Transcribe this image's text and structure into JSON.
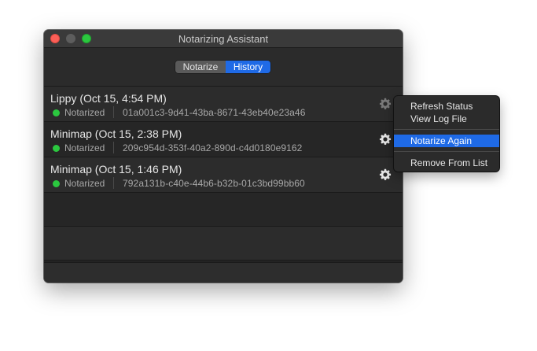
{
  "window": {
    "title": "Notarizing Assistant"
  },
  "tabs": {
    "notarize": "Notarize",
    "history": "History",
    "selected": "History"
  },
  "history": [
    {
      "name": "Lippy (Oct 15, 4:54 PM)",
      "status": "Notarized",
      "id": "01a001c3-9d41-43ba-8671-43eb40e23a46",
      "status_color": "#2bc83f"
    },
    {
      "name": "Minimap (Oct 15, 2:38 PM)",
      "status": "Notarized",
      "id": "209c954d-353f-40a2-890d-c4d0180e9162",
      "status_color": "#2bc83f"
    },
    {
      "name": "Minimap (Oct 15, 1:46 PM)",
      "status": "Notarized",
      "id": "792a131b-c40e-44b6-b32b-01c3bd99bb60",
      "status_color": "#2bc83f"
    }
  ],
  "context_menu": {
    "refresh_status": "Refresh Status",
    "view_log_file": "View Log File",
    "notarize_again": "Notarize Again",
    "remove_from_list": "Remove From List",
    "highlighted": "Notarize Again"
  },
  "colors": {
    "accent": "#1f6ae6",
    "success": "#2bc83f"
  },
  "icons": {
    "row_action": "gear-icon"
  }
}
